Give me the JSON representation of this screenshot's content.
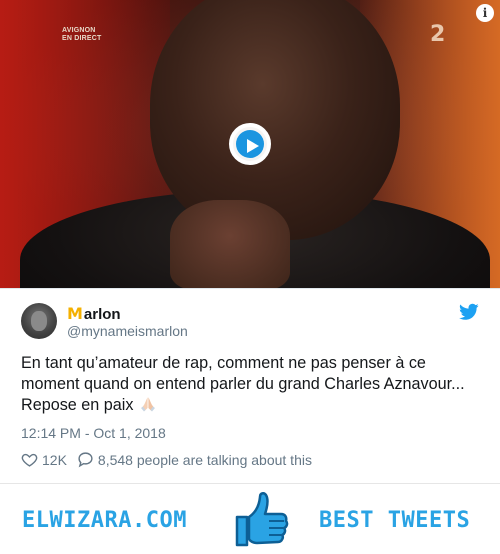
{
  "video": {
    "channel_line1": "AVIGNON",
    "channel_line2": "EN DIRECT",
    "tv_logo": "2",
    "info_icon": "info-icon",
    "play_icon": "play-icon"
  },
  "tweet": {
    "display_name_emoji": "M",
    "display_name": "arlon",
    "handle": "@mynameismarlon",
    "text": "En tant qu’amateur de rap, comment ne pas penser à ce moment quand on entend parler du grand Charles Aznavour... Repose en paix",
    "text_emoji": "praying-hands-icon",
    "timestamp": "12:14 PM - Oct 1, 2018",
    "likes": "12K",
    "replies_text": "8,548 people are talking about this"
  },
  "footer": {
    "brand_left": "ELWIZARA.COM",
    "brand_right": "BEST TWEETS"
  },
  "colors": {
    "twitter_blue": "#1da1f2",
    "brand_blue": "#2aa3e4",
    "handle_gray": "#657786",
    "name_emoji_gold": "#f4b000"
  }
}
